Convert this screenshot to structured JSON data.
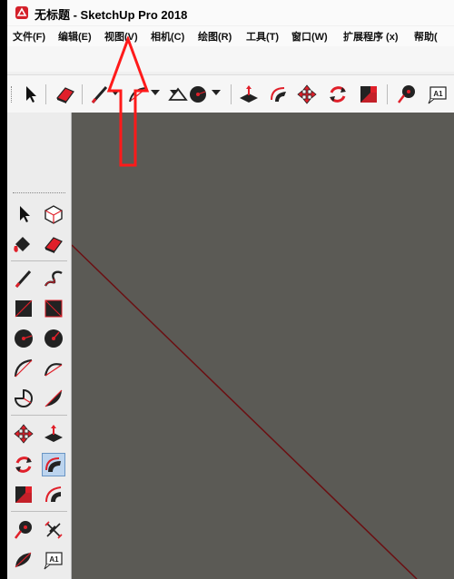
{
  "window": {
    "title": "无标题 - SketchUp Pro 2018"
  },
  "menu": [
    {
      "label": "文件(F)"
    },
    {
      "label": "编辑(E)"
    },
    {
      "label": "视图(V)"
    },
    {
      "label": "相机(C)"
    },
    {
      "label": "绘图(R)"
    },
    {
      "label": "工具(T)"
    },
    {
      "label": "窗口(W)"
    },
    {
      "label": "扩展程序 (x)"
    },
    {
      "label": "帮助("
    }
  ],
  "toolbar": {
    "tools": [
      "select-icon",
      "eraser-icon",
      "line-pencil-icon",
      "arc-icon",
      "circle-icon",
      "push-pull-icon",
      "follow-me-icon",
      "move-icon",
      "rotate-icon",
      "scale-icon",
      "tape-measure-icon",
      "text-icon"
    ],
    "text_tool_label": "A1"
  },
  "left_panel": {
    "tools": [
      "select-icon",
      "component-icon",
      "paint-bucket-icon",
      "eraser-icon",
      "line-icon",
      "freehand-icon",
      "rectangle-icon",
      "rotated-rectangle-icon",
      "circle-icon",
      "polygon-icon",
      "arc-icon",
      "two-point-arc-icon",
      "pie-icon",
      "three-point-arc-icon",
      "move-icon",
      "push-pull-icon",
      "rotate-icon",
      "follow-me-icon",
      "scale-icon",
      "offset-icon",
      "tape-measure-icon",
      "dimension-icon",
      "protractor-icon",
      "text-icon"
    ],
    "active_tool": "follow-me-icon",
    "text_tool_label": "A1"
  },
  "colors": {
    "accent": "#e0202a",
    "canvas": "#5b5a55",
    "annotation": "#ff1a1a"
  }
}
